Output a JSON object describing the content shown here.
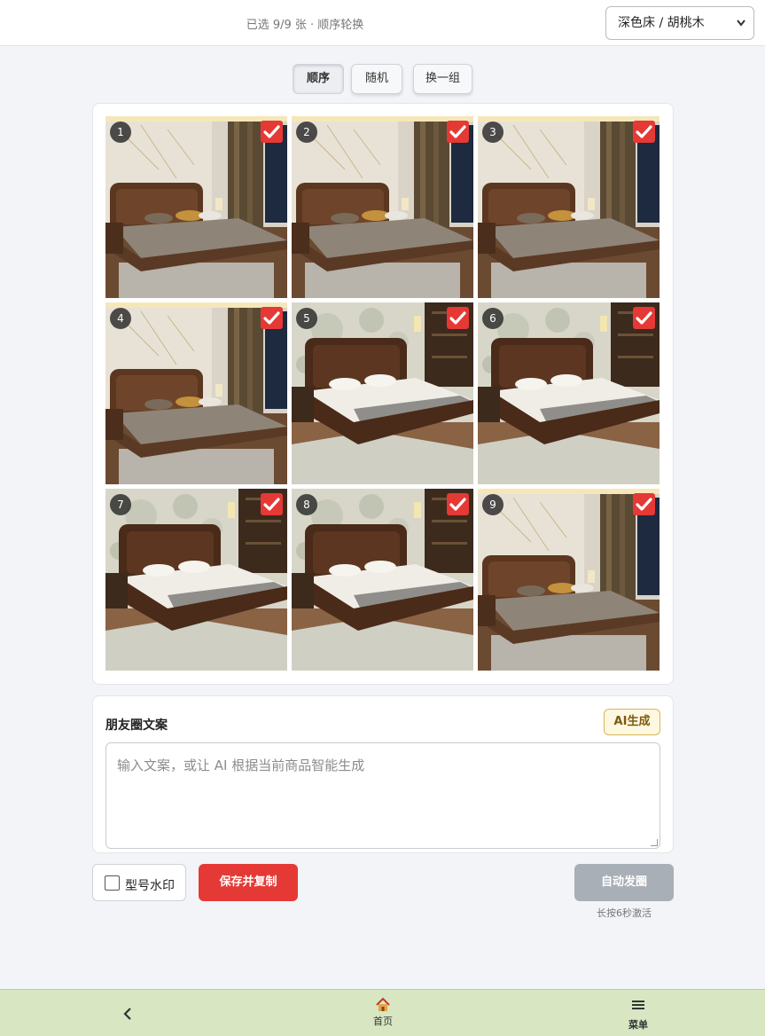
{
  "header": {
    "status_text": "已选 9/9 张 · 顺序轮换",
    "product_select": {
      "selected": "深色床 / 胡桃木"
    }
  },
  "modes": [
    {
      "label": "顺序",
      "active": true
    },
    {
      "label": "随机",
      "active": false
    },
    {
      "label": "换一组",
      "active": false
    }
  ],
  "photos": [
    {
      "index": "1",
      "selected": true,
      "style": "classic-gold-wall"
    },
    {
      "index": "2",
      "selected": true,
      "style": "classic-gold-wall"
    },
    {
      "index": "3",
      "selected": true,
      "style": "classic-gold-wall"
    },
    {
      "index": "4",
      "selected": true,
      "style": "classic-gold-wall"
    },
    {
      "index": "5",
      "selected": true,
      "style": "floral-mural"
    },
    {
      "index": "6",
      "selected": true,
      "style": "floral-mural"
    },
    {
      "index": "7",
      "selected": true,
      "style": "floral-mural"
    },
    {
      "index": "8",
      "selected": true,
      "style": "floral-mural"
    },
    {
      "index": "9",
      "selected": true,
      "style": "classic-gold-wall"
    }
  ],
  "caption": {
    "title": "朋友圈文案",
    "ai_button": "AI生成",
    "placeholder": "输入文案，或让 AI 根据当前商品智能生成"
  },
  "actions": {
    "watermark_label": "型号水印",
    "watermark_checked": false,
    "save_copy": "保存并复制",
    "auto_post": "自动发圈",
    "auto_post_hint": "长按6秒激活"
  },
  "bottom_nav": {
    "back_icon": "chevron-left-icon",
    "home_label": "首页",
    "home_icon": "house-icon",
    "menu_label": "菜单",
    "menu_icon": "hamburger-icon"
  },
  "colors": {
    "accent_red": "#e53935",
    "nav_bg": "#d8e6c2",
    "disabled_gray": "#a9afb6",
    "ai_border": "#d8b75a"
  }
}
